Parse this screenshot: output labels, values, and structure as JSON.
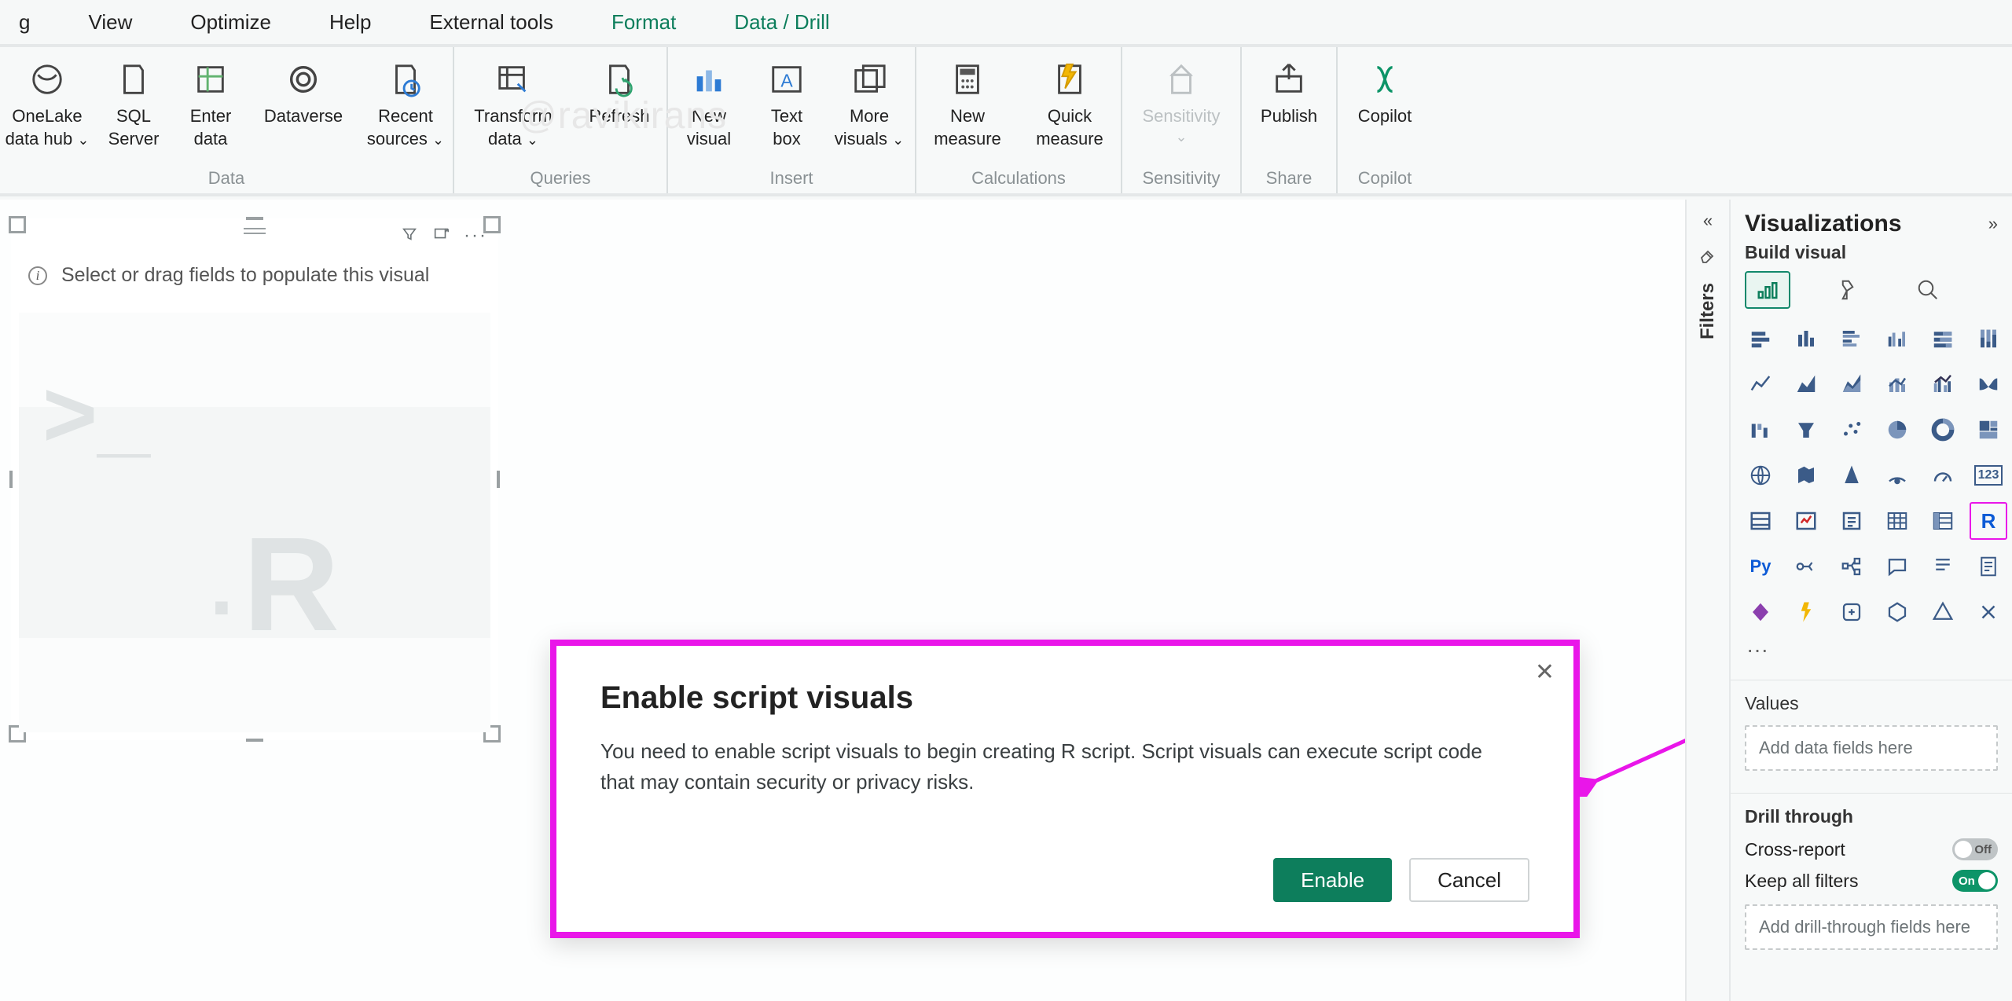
{
  "tabs": [
    {
      "label": "g",
      "active": false
    },
    {
      "label": "View",
      "active": false
    },
    {
      "label": "Optimize",
      "active": false
    },
    {
      "label": "Help",
      "active": false
    },
    {
      "label": "External tools",
      "active": false
    },
    {
      "label": "Format",
      "active": true
    },
    {
      "label": "Data / Drill",
      "active": true
    }
  ],
  "ribbon": {
    "groups": [
      {
        "label": "Data",
        "buttons": [
          {
            "name": "onelake-data-hub",
            "l1": "OneLake",
            "l2": "data hub",
            "drop": true
          },
          {
            "name": "sql-server",
            "l1": "SQL",
            "l2": "Server"
          },
          {
            "name": "enter-data",
            "l1": "Enter",
            "l2": "data"
          },
          {
            "name": "dataverse",
            "l1": "Dataverse",
            "l2": ""
          },
          {
            "name": "recent-sources",
            "l1": "Recent",
            "l2": "sources",
            "drop": true
          }
        ]
      },
      {
        "label": "Queries",
        "buttons": [
          {
            "name": "transform-data",
            "l1": "Transform",
            "l2": "data",
            "drop": true
          },
          {
            "name": "refresh",
            "l1": "Refresh",
            "l2": ""
          }
        ]
      },
      {
        "label": "Insert",
        "buttons": [
          {
            "name": "new-visual",
            "l1": "New",
            "l2": "visual"
          },
          {
            "name": "text-box",
            "l1": "Text",
            "l2": "box"
          },
          {
            "name": "more-visuals",
            "l1": "More",
            "l2": "visuals",
            "drop": true
          }
        ]
      },
      {
        "label": "Calculations",
        "buttons": [
          {
            "name": "new-measure",
            "l1": "New",
            "l2": "measure"
          },
          {
            "name": "quick-measure",
            "l1": "Quick",
            "l2": "measure"
          }
        ]
      },
      {
        "label": "Sensitivity",
        "buttons": [
          {
            "name": "sensitivity",
            "l1": "Sensitivity",
            "l2": "",
            "drop": true,
            "disabled": true
          }
        ]
      },
      {
        "label": "Share",
        "buttons": [
          {
            "name": "publish",
            "l1": "Publish",
            "l2": ""
          }
        ]
      },
      {
        "label": "Copilot",
        "buttons": [
          {
            "name": "copilot",
            "l1": "Copilot",
            "l2": ""
          }
        ]
      }
    ]
  },
  "watermark": "@ravikirans",
  "visual": {
    "hint": "Select or drag fields to populate this visual"
  },
  "dialog": {
    "title": "Enable script visuals",
    "body": "You need to enable script visuals to begin creating R script. Script visuals can execute script code that may contain security or privacy risks.",
    "enable": "Enable",
    "cancel": "Cancel"
  },
  "filters": {
    "label": "Filters"
  },
  "viz": {
    "title": "Visualizations",
    "subtitle": "Build visual",
    "values_label": "Values",
    "values_placeholder": "Add data fields here",
    "drill_label": "Drill through",
    "cross_report": "Cross-report",
    "cross_report_state": "Off",
    "keep_filters": "Keep all filters",
    "keep_filters_state": "On",
    "drill_placeholder": "Add drill-through fields here",
    "gallery": [
      "stacked-bar",
      "stacked-column",
      "clustered-bar",
      "clustered-column",
      "100-stacked-bar",
      "100-stacked-column",
      "line",
      "area",
      "stacked-area",
      "line-stacked-column",
      "line-clustered-column",
      "ribbon",
      "waterfall",
      "funnel",
      "scatter",
      "pie",
      "donut",
      "treemap",
      "map",
      "filled-map",
      "azure-map",
      "arcgis",
      "gauge",
      "card-123",
      "multi-row-card",
      "kpi",
      "slicer",
      "table",
      "matrix",
      "r-visual",
      "py-visual",
      "key-influencers",
      "decomposition-tree",
      "qna",
      "smart-narrative",
      "paginated",
      "power-apps",
      "power-automate",
      "app-source",
      "get-visuals",
      "shape",
      "more"
    ]
  }
}
